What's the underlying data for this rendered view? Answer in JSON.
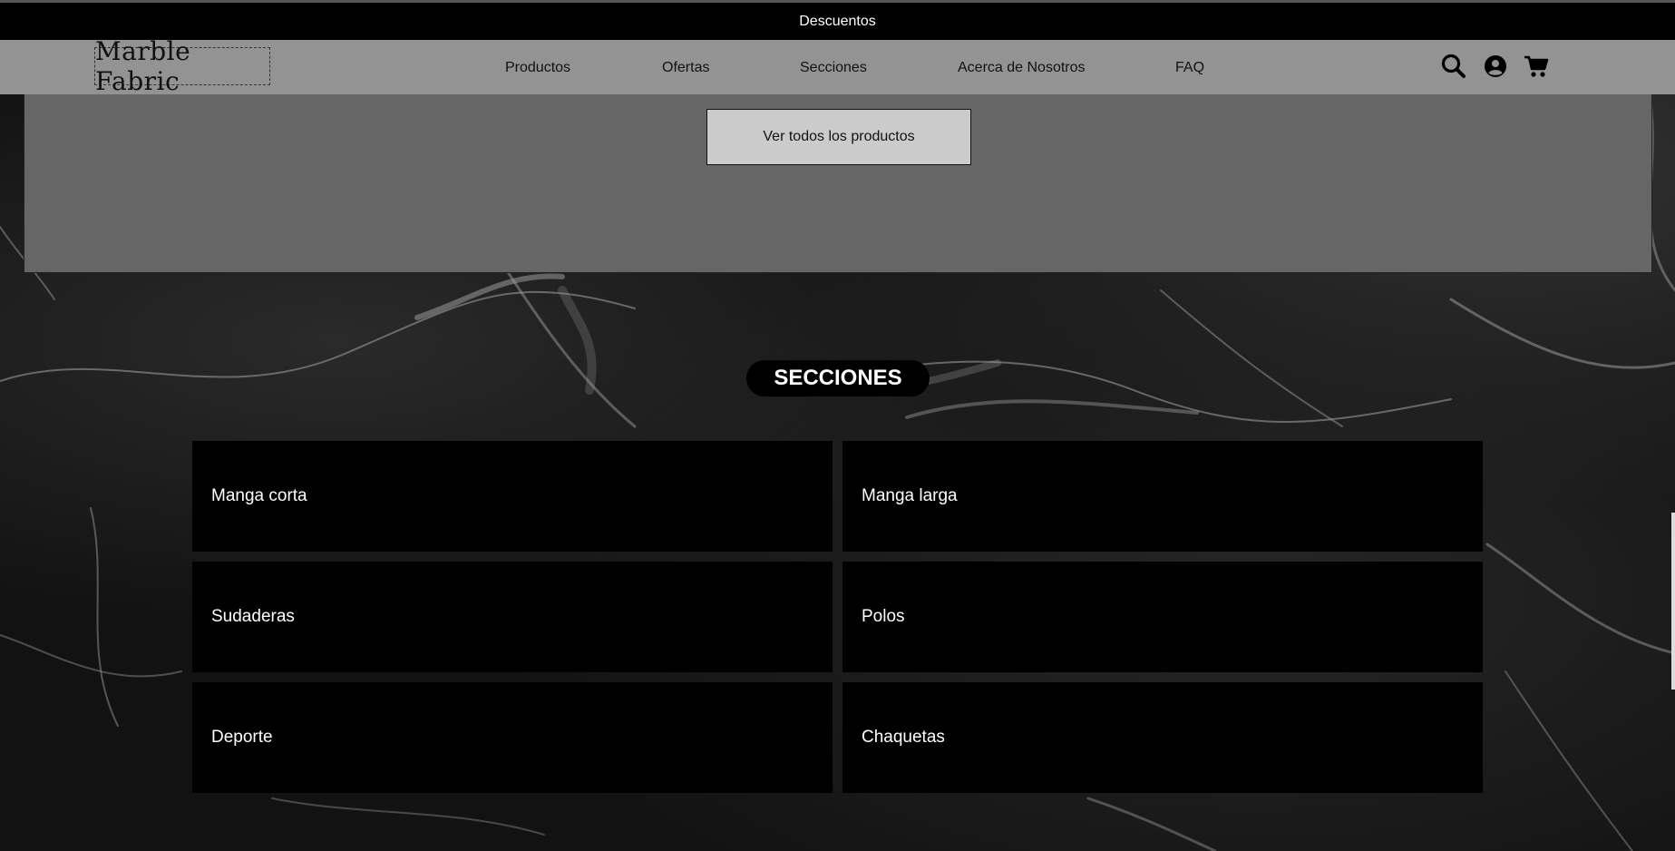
{
  "announcement": {
    "text": "Descuentos"
  },
  "header": {
    "logo_text": "Marble Fabric",
    "nav": [
      {
        "label": "Productos"
      },
      {
        "label": "Ofertas"
      },
      {
        "label": "Secciones"
      },
      {
        "label": "Acerca de Nosotros"
      },
      {
        "label": "FAQ"
      }
    ],
    "icons": [
      "search-icon",
      "account-icon",
      "cart-icon"
    ]
  },
  "products": {
    "view_all_label": "Ver todos los productos"
  },
  "sections": {
    "title": "SECCIONES",
    "items": [
      {
        "label": "Manga corta"
      },
      {
        "label": "Manga larga"
      },
      {
        "label": "Sudaderas"
      },
      {
        "label": "Polos"
      },
      {
        "label": "Deporte"
      },
      {
        "label": "Chaquetas"
      }
    ]
  },
  "colors": {
    "topbar": "#000000",
    "navbar": "#939393",
    "panel": "#666666",
    "card": "#000000"
  }
}
